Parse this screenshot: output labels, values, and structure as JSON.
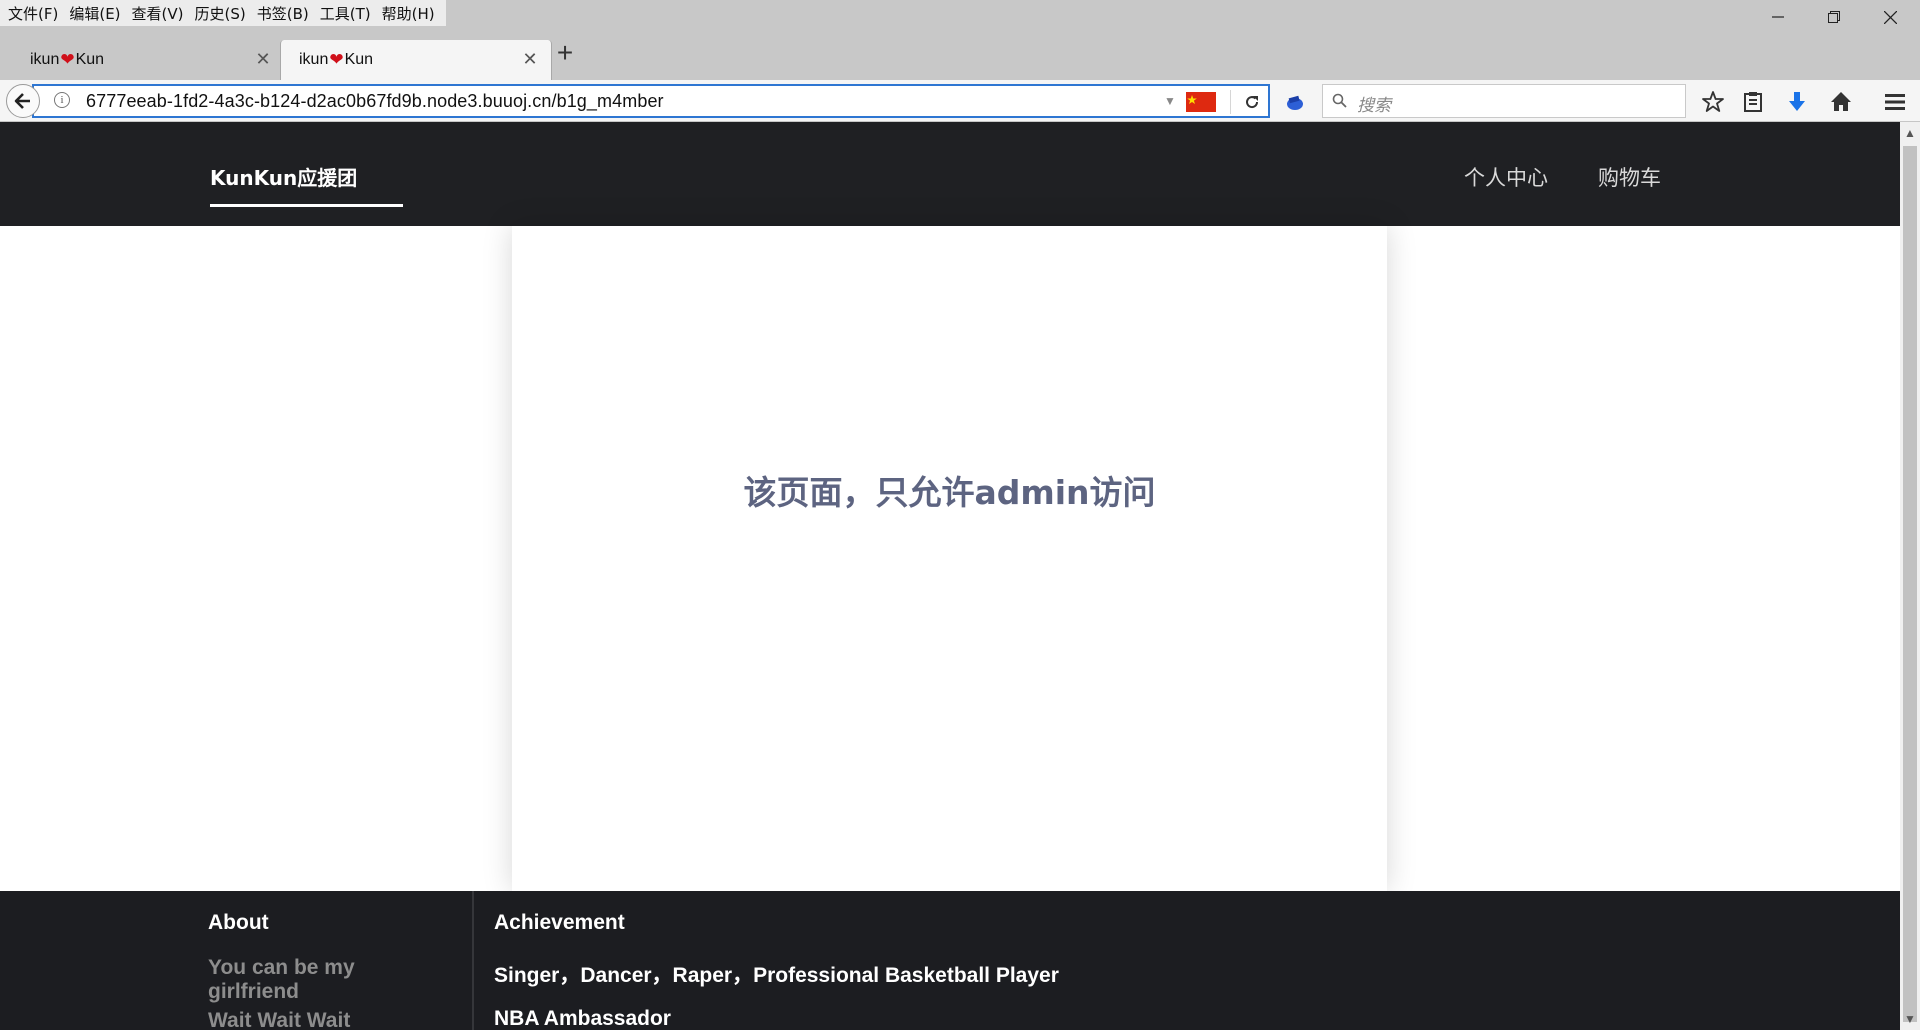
{
  "browser": {
    "menu": [
      "文件(F)",
      "编辑(E)",
      "查看(V)",
      "历史(S)",
      "书签(B)",
      "工具(T)",
      "帮助(H)"
    ],
    "tabs": [
      {
        "title_prefix": "ikun",
        "title_suffix": "Kun",
        "active": false
      },
      {
        "title_prefix": "ikun",
        "title_suffix": "Kun",
        "active": true
      }
    ],
    "url": "6777eeab-1fd2-4a3c-b124-d2ac0b67fd9b.node3.buuoj.cn/b1g_m4mber",
    "search_placeholder": "搜索",
    "colors": {
      "focus_ring": "#2e76d2",
      "chrome": "#c8c8c8"
    }
  },
  "site": {
    "brand": "KunKun应援团",
    "nav_links": [
      "个人中心",
      "购物车"
    ],
    "notice": "该页面，只允许admin访问",
    "footer": {
      "about_heading": "About",
      "about_line1": "You can be my",
      "about_line2": "girlfriend",
      "about_line3": "Wait Wait Wait",
      "achievement_heading": "Achievement",
      "achievement_line1": "Singer，Dancer，Raper，Professional Basketball Player",
      "achievement_line2": "NBA Ambassador"
    },
    "colors": {
      "navbar_bg": "#1f2023",
      "notice_text": "#5d6481",
      "footer_bg": "#1c1d21"
    }
  }
}
